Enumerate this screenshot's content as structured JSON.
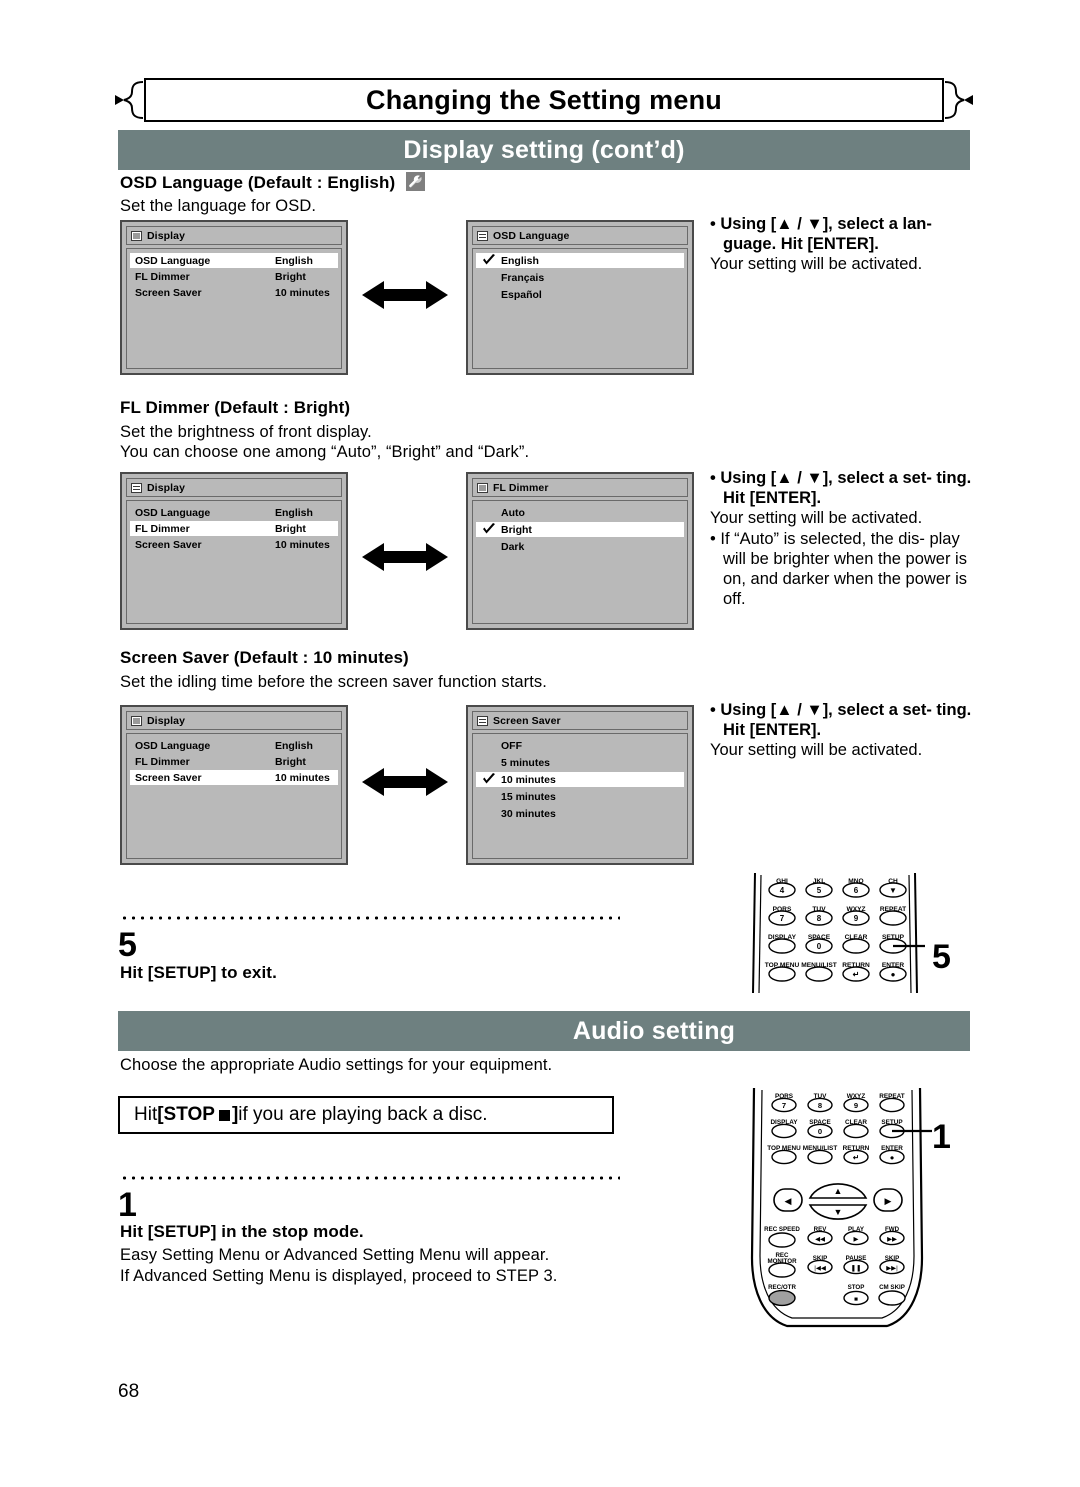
{
  "page": {
    "number": "68",
    "title": "Changing the Setting menu"
  },
  "sections": [
    {
      "id": "display",
      "label": "Display setting (cont’d)"
    },
    {
      "id": "audio",
      "label": "Audio setting"
    }
  ],
  "display_setting": {
    "items": [
      {
        "heading": "OSD Language (Default : English)",
        "icon": "wrench-icon",
        "description_lines": [
          "Set the language for OSD."
        ],
        "left_menu": {
          "title": "Display",
          "title_icon": "window-icon",
          "rows": [
            {
              "label": "OSD Language",
              "value": "English",
              "selected": true
            },
            {
              "label": "FL Dimmer",
              "value": "Bright",
              "selected": false
            },
            {
              "label": "Screen Saver",
              "value": "10 minutes",
              "selected": false
            }
          ]
        },
        "right_menu": {
          "title": "OSD Language",
          "title_icon": "list-icon",
          "options": [
            {
              "label": "English",
              "checked": true,
              "selected": true
            },
            {
              "label": "Français",
              "checked": false,
              "selected": false
            },
            {
              "label": "Español",
              "checked": false,
              "selected": false
            }
          ]
        },
        "instructions": [
          {
            "bold": "• Using [▲ / ▼], select a lan-",
            "indent": false
          },
          {
            "bold": "guage. Hit [ENTER].",
            "indent": true
          },
          {
            "norm": "Your setting will be activated."
          }
        ]
      },
      {
        "heading": "FL Dimmer (Default : Bright)",
        "icon": null,
        "description_lines": [
          "Set the brightness of front display.",
          "You can choose one among “Auto”, “Bright” and “Dark”."
        ],
        "left_menu": {
          "title": "Display",
          "title_icon": "list-icon",
          "rows": [
            {
              "label": "OSD Language",
              "value": "English",
              "selected": false
            },
            {
              "label": "FL Dimmer",
              "value": "Bright",
              "selected": true
            },
            {
              "label": "Screen Saver",
              "value": "10 minutes",
              "selected": false
            }
          ]
        },
        "right_menu": {
          "title": "FL Dimmer",
          "title_icon": "window-icon",
          "options": [
            {
              "label": "Auto",
              "checked": false,
              "selected": false
            },
            {
              "label": "Bright",
              "checked": true,
              "selected": true
            },
            {
              "label": "Dark",
              "checked": false,
              "selected": false
            }
          ]
        },
        "instructions": [
          {
            "bold": "• Using [▲ / ▼], select a set-",
            "indent": false
          },
          {
            "bold": "ting. Hit [ENTER].",
            "indent": true
          },
          {
            "norm": "Your setting will be activated."
          },
          {
            "norm2": "• If “Auto” is selected, the dis-"
          },
          {
            "norm2b": "play will be brighter when the"
          },
          {
            "norm2c": "power is on, and darker when"
          },
          {
            "norm2d": "the power is off."
          }
        ]
      },
      {
        "heading": "Screen Saver (Default : 10 minutes)",
        "icon": null,
        "description_lines": [
          "Set the idling time before the screen saver function starts."
        ],
        "left_menu": {
          "title": "Display",
          "title_icon": "window-icon",
          "rows": [
            {
              "label": "OSD Language",
              "value": "English",
              "selected": false
            },
            {
              "label": "FL Dimmer",
              "value": "Bright",
              "selected": false
            },
            {
              "label": "Screen Saver",
              "value": "10 minutes",
              "selected": true
            }
          ]
        },
        "right_menu": {
          "title": "Screen Saver",
          "title_icon": "list-icon",
          "options": [
            {
              "label": "OFF",
              "checked": false,
              "selected": false
            },
            {
              "label": "5 minutes",
              "checked": false,
              "selected": false
            },
            {
              "label": "10 minutes",
              "checked": true,
              "selected": true
            },
            {
              "label": "15 minutes",
              "checked": false,
              "selected": false
            },
            {
              "label": "30 minutes",
              "checked": false,
              "selected": false
            }
          ]
        },
        "instructions": [
          {
            "bold": "• Using [▲ / ▼], select a set-",
            "indent": false
          },
          {
            "bold": "ting. Hit [ENTER].",
            "indent": true
          },
          {
            "norm": "Your setting will be activated."
          }
        ]
      }
    ]
  },
  "steps": [
    {
      "number": "5",
      "instruction": "Hit [SETUP] to exit.",
      "callout": "5"
    },
    {
      "number": "1",
      "instruction": "Hit [SETUP] in the stop mode.",
      "detail_lines": [
        "Easy Setting Menu or Advanced Setting Menu will appear.",
        "If Advanced Setting Menu is displayed, proceed to STEP 3."
      ],
      "callout": "1"
    }
  ],
  "audio_setting": {
    "intro": "Choose the appropriate Audio settings for your equipment.",
    "boxed_note": {
      "pre": "Hit ",
      "bold": "[STOP ",
      "icon": "stop-square-icon",
      "bold_end": "]",
      "post": " if you are playing back a disc."
    }
  },
  "remote_top": {
    "rows": [
      [
        {
          "top": "GHI",
          "key": "4",
          "shape": "oval"
        },
        {
          "top": "JKL",
          "key": "5",
          "shape": "oval"
        },
        {
          "top": "MNO",
          "key": "6",
          "shape": "oval"
        },
        {
          "top": "CH",
          "key": "▼",
          "shape": "oval"
        }
      ],
      [
        {
          "top": "PQRS",
          "key": "7",
          "shape": "oval"
        },
        {
          "top": "TUV",
          "key": "8",
          "shape": "oval"
        },
        {
          "top": "WXYZ",
          "key": "9",
          "shape": "oval"
        },
        {
          "top": "REPEAT",
          "key": "",
          "shape": "oval"
        }
      ],
      [
        {
          "top": "DISPLAY",
          "key": "",
          "shape": "oval"
        },
        {
          "top": "SPACE",
          "key": "0",
          "shape": "oval"
        },
        {
          "top": "CLEAR",
          "key": "",
          "shape": "oval"
        },
        {
          "top": "SETUP",
          "key": "",
          "shape": "oval",
          "highlight": true
        }
      ],
      [
        {
          "top": "TOP MENU",
          "key": "",
          "shape": "oval"
        },
        {
          "top": "MENU/LIST",
          "key": "",
          "shape": "oval"
        },
        {
          "top": "RETURN",
          "key": "↵",
          "shape": "oval"
        },
        {
          "top": "ENTER",
          "key": "●",
          "shape": "oval"
        }
      ]
    ]
  },
  "remote_bottom": {
    "rows": [
      [
        {
          "top": "PQRS",
          "key": "7"
        },
        {
          "top": "TUV",
          "key": "8"
        },
        {
          "top": "WXYZ",
          "key": "9"
        },
        {
          "top": "REPEAT",
          "key": ""
        }
      ],
      [
        {
          "top": "DISPLAY",
          "key": ""
        },
        {
          "top": "SPACE",
          "key": "0"
        },
        {
          "top": "CLEAR",
          "key": ""
        },
        {
          "top": "SETUP",
          "key": "",
          "highlight": true
        }
      ],
      [
        {
          "top": "TOP MENU",
          "key": ""
        },
        {
          "top": "MENU/LIST",
          "key": ""
        },
        {
          "top": "RETURN",
          "key": "↵"
        },
        {
          "top": "ENTER",
          "key": "●"
        }
      ]
    ],
    "dpad": {
      "up": "▲",
      "down": "▼",
      "left": "◀",
      "right": "▶"
    },
    "transport_rows": [
      [
        {
          "top": "REC SPEED",
          "key": ""
        },
        {
          "top": "REV",
          "key": "◀◀"
        },
        {
          "top": "PLAY",
          "key": "▶"
        },
        {
          "top": "FWD",
          "key": "▶▶"
        }
      ],
      [
        {
          "top": "REC MONITOR",
          "key": ""
        },
        {
          "top": "SKIP",
          "key": "|◀◀"
        },
        {
          "top": "PAUSE",
          "key": "‖"
        },
        {
          "top": "SKIP",
          "key": "▶▶|"
        }
      ],
      [
        {
          "top": "REC/OTR",
          "key": "",
          "filled": true
        },
        {
          "top": "",
          "key": ""
        },
        {
          "top": "STOP",
          "key": "■"
        },
        {
          "top": "CM SKIP",
          "key": ""
        }
      ]
    ]
  },
  "colors": {
    "banner": "#6e8080",
    "osd_bg": "#b9b9b9",
    "osd_border": "#4a4a4a",
    "selected_row": "#ffffff"
  }
}
